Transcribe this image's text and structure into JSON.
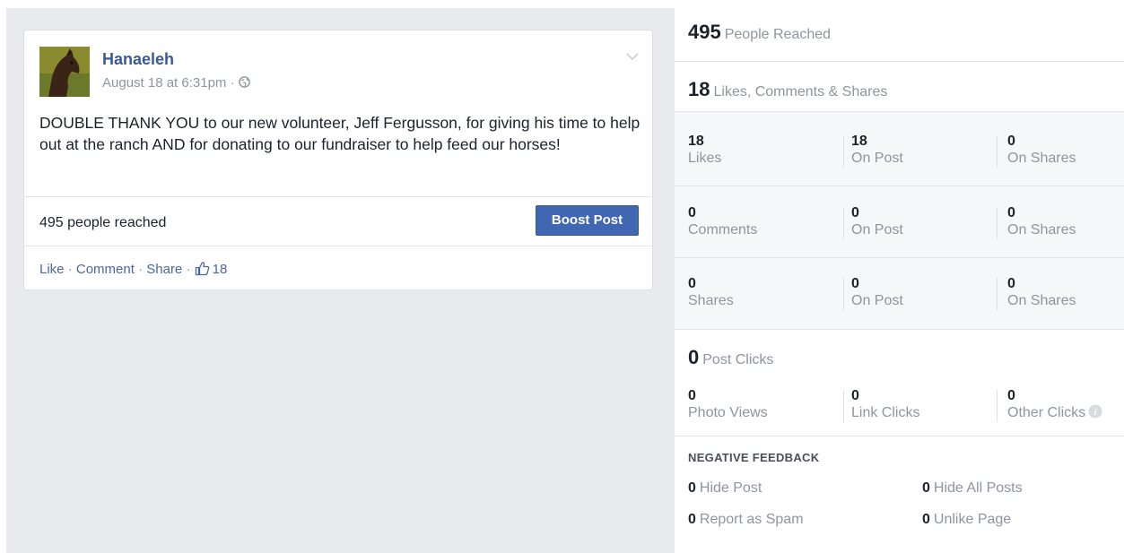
{
  "post": {
    "author": "Hanaeleh",
    "timestamp": "August 18 at 6:31pm · ",
    "text": "DOUBLE THANK YOU to our new volunteer, Jeff Fergusson, for giving his time to help out at the ranch AND for donating to our fundraiser to help feed our horses!",
    "reach_text": "495 people reached",
    "boost_label": "Boost Post",
    "actions": {
      "like": "Like",
      "comment": "Comment",
      "share": "Share",
      "separator": " · ",
      "like_count": "18"
    }
  },
  "stats": {
    "reached": {
      "value": "495",
      "label": "People Reached"
    },
    "engagement": {
      "value": "18",
      "label": "Likes, Comments & Shares"
    },
    "likes": [
      {
        "value": "18",
        "label": "Likes"
      },
      {
        "value": "18",
        "label": "On Post"
      },
      {
        "value": "0",
        "label": "On Shares"
      }
    ],
    "comments": [
      {
        "value": "0",
        "label": "Comments"
      },
      {
        "value": "0",
        "label": "On Post"
      },
      {
        "value": "0",
        "label": "On Shares"
      }
    ],
    "shares": [
      {
        "value": "0",
        "label": "Shares"
      },
      {
        "value": "0",
        "label": "On Post"
      },
      {
        "value": "0",
        "label": "On Shares"
      }
    ],
    "post_clicks": {
      "value": "0",
      "label": "Post Clicks"
    },
    "clicks": [
      {
        "value": "0",
        "label": "Photo Views"
      },
      {
        "value": "0",
        "label": "Link Clicks"
      },
      {
        "value": "0",
        "label": "Other Clicks"
      }
    ],
    "negative_feedback": {
      "title": "NEGATIVE FEEDBACK",
      "hide_post": {
        "value": "0",
        "label": "Hide Post"
      },
      "hide_all": {
        "value": "0",
        "label": "Hide All Posts"
      },
      "spam": {
        "value": "0",
        "label": "Report as Spam"
      },
      "unlike": {
        "value": "0",
        "label": "Unlike Page"
      }
    }
  },
  "colors": {
    "brand_blue": "#3b5998",
    "button_blue": "#4267b2",
    "link_blue": "#4b67a1",
    "muted_gray": "#90949c",
    "pane_gray": "#e9eaed"
  },
  "icons": {
    "chevron": "chevron-down-icon",
    "globe": "globe-icon",
    "thumb": "thumbs-up-icon",
    "info": "info-icon"
  }
}
